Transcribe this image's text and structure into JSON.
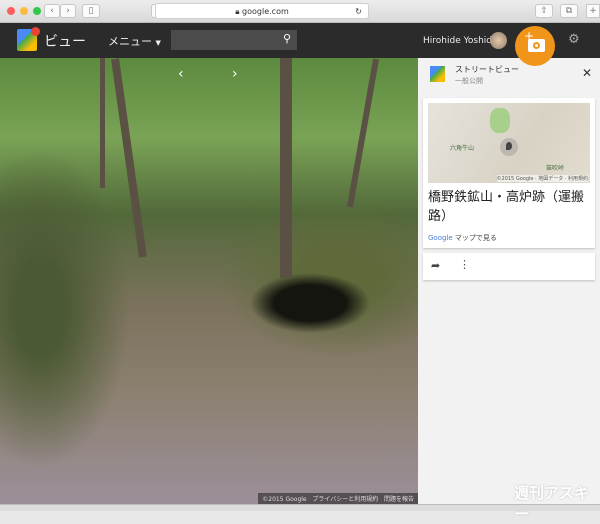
{
  "browser": {
    "url": "google.com"
  },
  "appbar": {
    "title": "ビュー",
    "menu": "メニュー",
    "search_placeholder": "",
    "user": "Hirohide Yoshida"
  },
  "panel": {
    "header_title": "ストリートビュー",
    "header_sub": "一般公開",
    "map_label": "六角牛山",
    "map_label2": "笛吹峠",
    "map_copyright": "©2015 Google · 地図データ · 利用規約",
    "place_title": "橋野鉄鉱山・高炉跡（運搬路）",
    "maps_link_google": "Google",
    "maps_link_rest": " マップで見る"
  },
  "footer": {
    "copyright": "©2015 Google",
    "privacy": "プライバシーと利用規約",
    "report": "問題を報告"
  },
  "watermark": "週刊アスキー",
  "colors": {
    "accent": "#f0951a",
    "appbar": "#2b2b2b",
    "link": "#4a7fd4"
  }
}
